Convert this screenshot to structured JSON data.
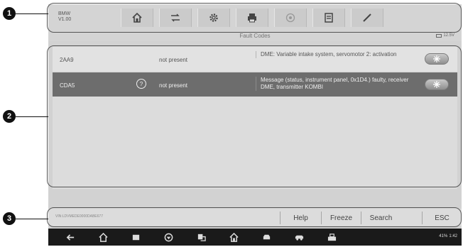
{
  "callouts": [
    "1",
    "2",
    "3"
  ],
  "header": {
    "brand_line1": "BMW",
    "brand_line2": "V1.00"
  },
  "toolbar": {
    "buttons": [
      {
        "name": "home-icon"
      },
      {
        "name": "vehicle-swap-icon"
      },
      {
        "name": "settings-gear-icon"
      },
      {
        "name": "print-icon"
      },
      {
        "name": "help-icon"
      },
      {
        "name": "save-icon"
      },
      {
        "name": "edit-pen-icon"
      }
    ]
  },
  "title_bar": {
    "title": "Fault Codes",
    "battery": "12.5V"
  },
  "fault_codes": [
    {
      "code": "2AA9",
      "status": "not present",
      "description": "DME: Variable intake system, servomotor 2: activation",
      "selected": false
    },
    {
      "code": "CDA5",
      "status": "not present",
      "description": "Message (status, instrument panel, 0x1D4.) faulty, receiver DME, transmitter KOMBI",
      "selected": true,
      "help_icon": "?"
    }
  ],
  "function_bar": {
    "vin": "VIN:LDVMEDE0000DABE677",
    "help": "Help",
    "freeze": "Freeze",
    "search": "Search",
    "esc": "ESC"
  },
  "nav_bar": {
    "icons": [
      "back-icon",
      "home-icon",
      "recent-apps-icon",
      "browser-icon",
      "screenshot-icon",
      "maxisys-home-icon",
      "vehicle-icon",
      "car-icon",
      "vci-icon"
    ],
    "status": "41%",
    "time": "1:42"
  },
  "colors": {
    "selected_row": "#6d6d6d",
    "screen_bg": "#d2d2d2",
    "nav_bar": "#1a1a1a"
  }
}
